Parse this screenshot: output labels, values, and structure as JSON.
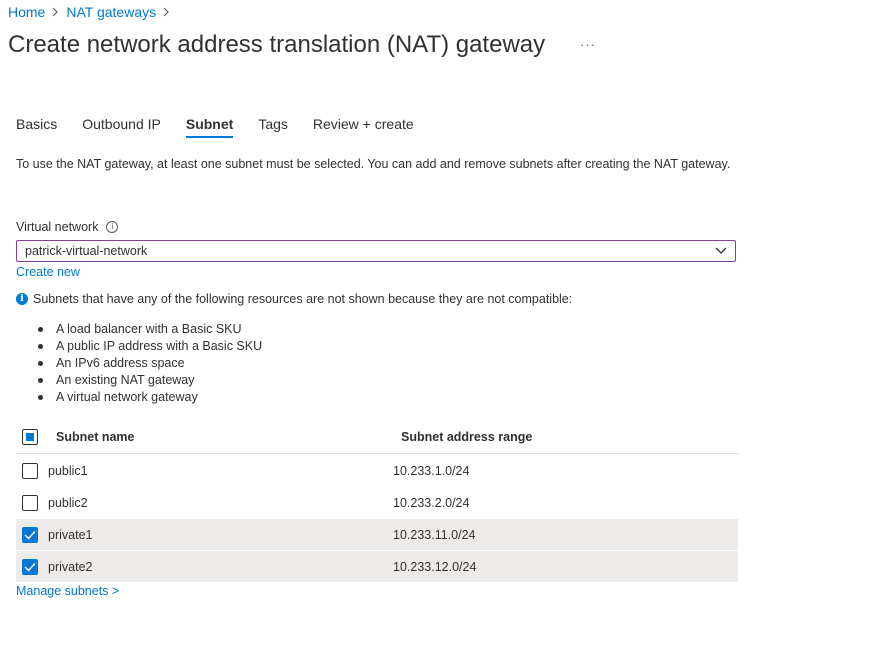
{
  "breadcrumb": {
    "items": [
      "Home",
      "NAT gateways"
    ]
  },
  "page": {
    "title": "Create network address translation (NAT) gateway",
    "more_label": "···"
  },
  "tabs": [
    {
      "label": "Basics",
      "active": false
    },
    {
      "label": "Outbound IP",
      "active": false
    },
    {
      "label": "Subnet",
      "active": true
    },
    {
      "label": "Tags",
      "active": false
    },
    {
      "label": "Review + create",
      "active": false
    }
  ],
  "intro": "To use the NAT gateway, at least one subnet must be selected. You can add and remove subnets after creating the NAT gateway.",
  "virtual_network": {
    "label": "Virtual network",
    "value": "patrick-virtual-network",
    "create_new": "Create new"
  },
  "notice": {
    "text": "Subnets that have any of the following resources are not shown because they are not compatible:",
    "items": [
      "A load balancer with a Basic SKU",
      "A public IP address with a Basic SKU",
      "An IPv6 address space",
      "An existing NAT gateway",
      "A virtual network gateway"
    ]
  },
  "subnet_table": {
    "columns": [
      "Subnet name",
      "Subnet address range"
    ],
    "select_all_state": "partial",
    "rows": [
      {
        "name": "public1",
        "range": "10.233.1.0/24",
        "checked": false
      },
      {
        "name": "public2",
        "range": "10.233.2.0/24",
        "checked": false
      },
      {
        "name": "private1",
        "range": "10.233.11.0/24",
        "checked": true
      },
      {
        "name": "private2",
        "range": "10.233.12.0/24",
        "checked": true
      }
    ]
  },
  "manage_subnets": "Manage subnets >",
  "colors": {
    "accent": "#0078d4",
    "focus_border": "#8a3da0",
    "selected_row": "#edebe9"
  }
}
